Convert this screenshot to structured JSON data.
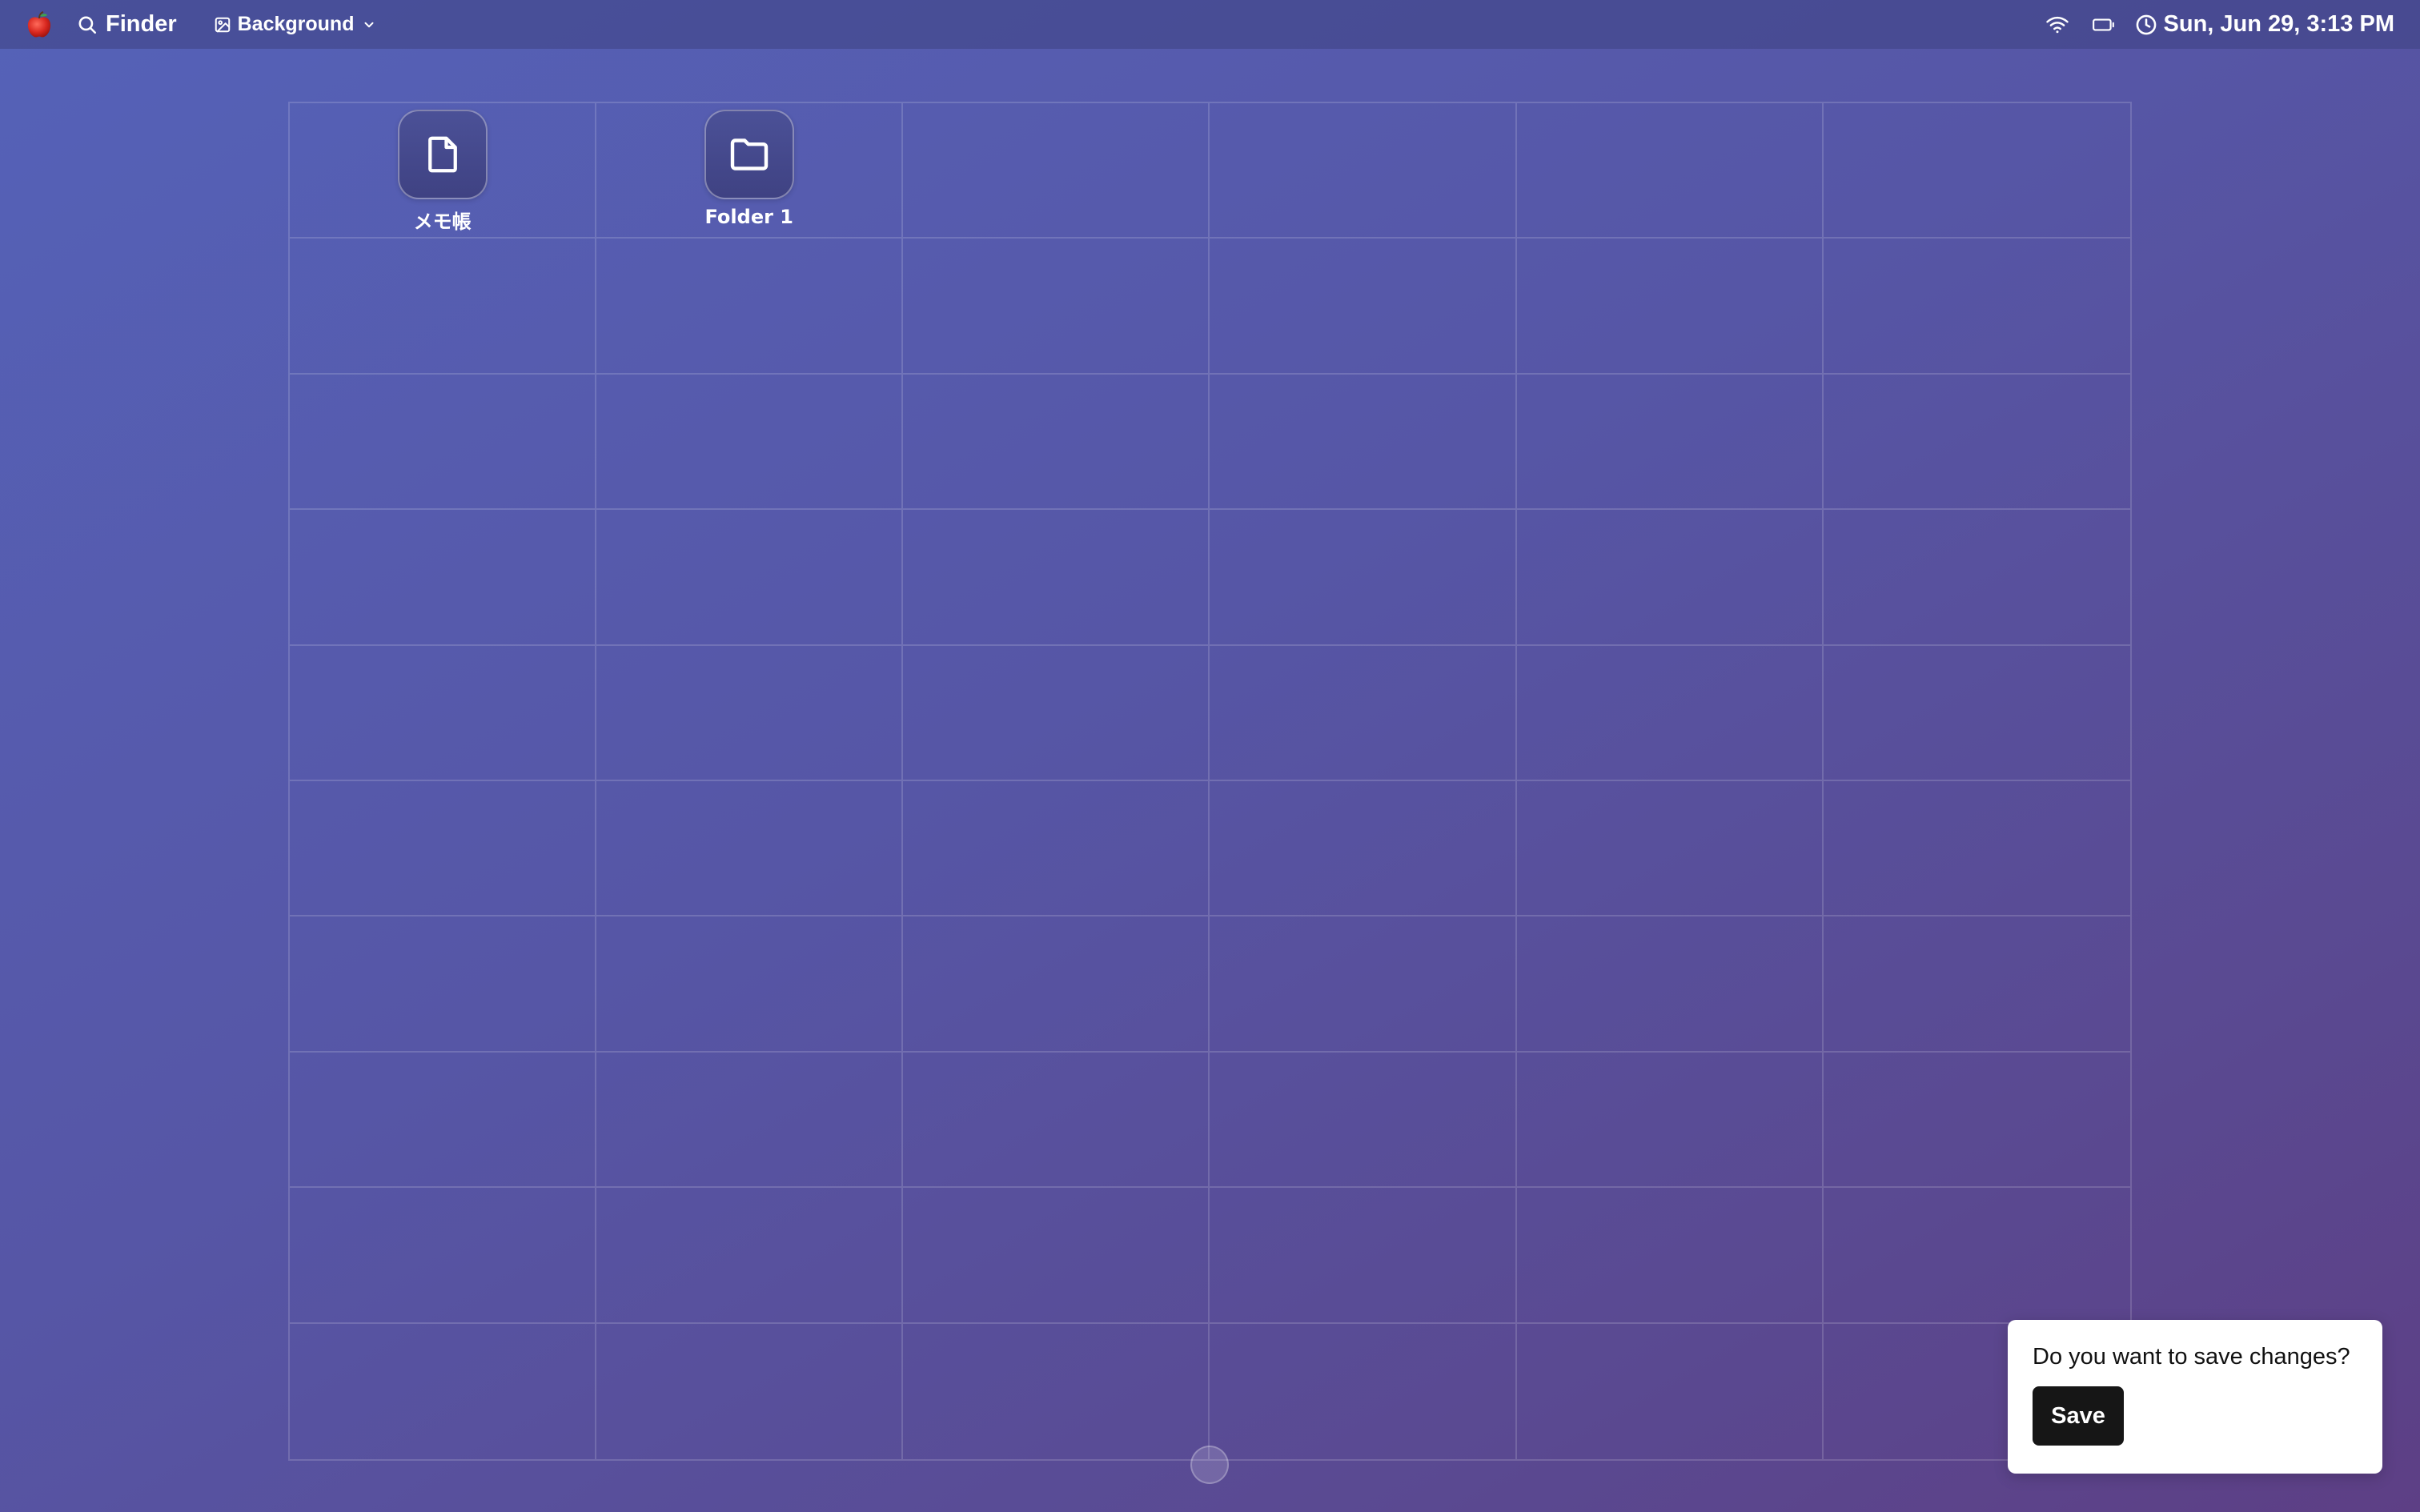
{
  "menubar": {
    "apple_icon": "apple-icon",
    "app_name": "Finder",
    "background_menu_label": "Background",
    "datetime": "Sun, Jun 29, 3:13 PM"
  },
  "desktop": {
    "items": [
      {
        "label": "メモ帳",
        "icon": "document-icon"
      },
      {
        "label": "Folder 1",
        "icon": "folder-icon"
      }
    ]
  },
  "dialog": {
    "message": "Do you want to save changes?",
    "save_label": "Save"
  }
}
